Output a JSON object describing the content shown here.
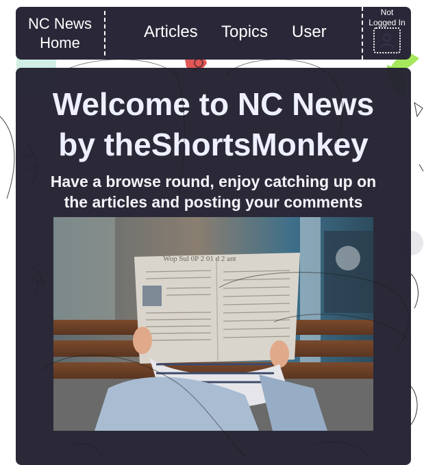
{
  "nav": {
    "home_label_line1": "NC News",
    "home_label_line2": "Home",
    "articles_label": "Articles",
    "topics_label": "Topics",
    "user_label": "User",
    "login_status_line1": "Not",
    "login_status_line2": "Logged In",
    "avatar_icon": "user-placeholder-icon"
  },
  "main": {
    "title_line1": "Welcome to NC News",
    "title_line2": "by theShortsMonkey",
    "subtitle_line1": "Have a browse round, enjoy catching up on",
    "subtitle_line2": "the articles and posting your comments",
    "hero_image": "person-reading-newspaper-on-bench",
    "newspaper_masthead": "Wop Sul 0P 2 01 d 2 ant"
  },
  "colors": {
    "panel_bg": "#2a2838",
    "main_bg": "#222030",
    "text": "#ffffff",
    "accent_leaf": "#9de05a"
  }
}
